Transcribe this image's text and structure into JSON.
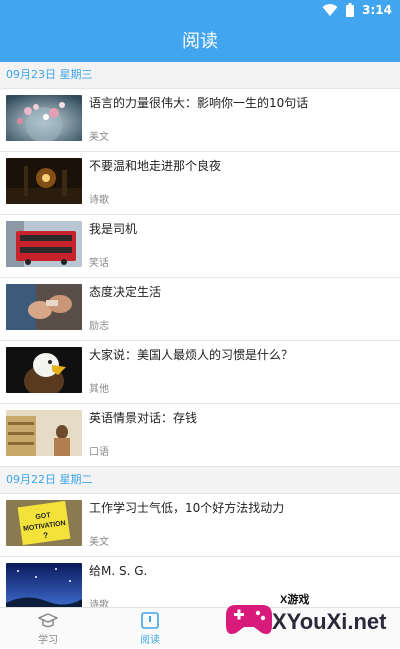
{
  "status": {
    "time": "3:14"
  },
  "appbar": {
    "title": "阅读"
  },
  "sections": [
    {
      "date": "09月23日 星期三",
      "items": [
        {
          "title": "语言的力量很伟大：影响你一生的10句话",
          "tag": "美文",
          "thumb": "bubbles"
        },
        {
          "title": "不要温和地走进那个良夜",
          "tag": "诗歌",
          "thumb": "night-street"
        },
        {
          "title": "我是司机",
          "tag": "笑话",
          "thumb": "red-bus"
        },
        {
          "title": "态度决定生活",
          "tag": "励志",
          "thumb": "hands"
        },
        {
          "title": "大家说：美国人最烦人的习惯是什么？",
          "tag": "其他",
          "thumb": "eagle"
        },
        {
          "title": "英语情景对话：存钱",
          "tag": "口语",
          "thumb": "shop"
        }
      ]
    },
    {
      "date": "09月22日 星期二",
      "items": [
        {
          "title": "工作学习士气低，10个好方法找动力",
          "tag": "美文",
          "thumb": "motivation-note"
        },
        {
          "title": "给M. S. G.",
          "tag": "诗歌",
          "thumb": "starry-sky"
        }
      ]
    }
  ],
  "thumb_text": {
    "motivation": "GOT MOTIVATION ?"
  },
  "tabs": [
    {
      "label": "学习",
      "icon": "graduation-cap-icon",
      "active": false
    },
    {
      "label": "阅读",
      "icon": "book-icon",
      "active": true
    }
  ],
  "watermark": {
    "brand": "XYouXi.net",
    "small": "X游戏"
  },
  "colors": {
    "accent": "#42a5ef",
    "date_text": "#3ba6e8"
  }
}
